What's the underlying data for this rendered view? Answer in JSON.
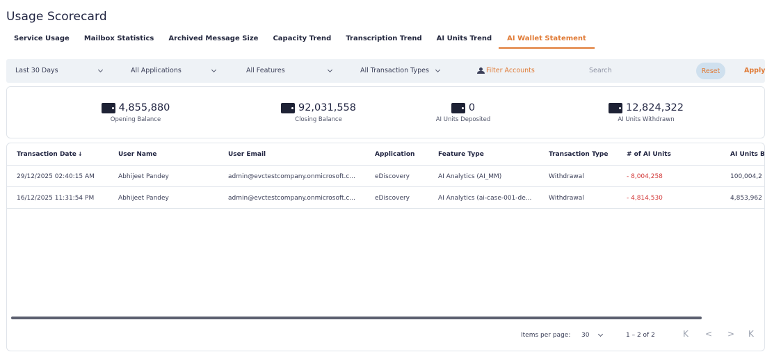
{
  "page": {
    "title": "Usage Scorecard"
  },
  "tabs": [
    {
      "label": "Service Usage",
      "active": false
    },
    {
      "label": "Mailbox Statistics",
      "active": false
    },
    {
      "label": "Archived Message Size",
      "active": false
    },
    {
      "label": "Capacity Trend",
      "active": false
    },
    {
      "label": "Transcription Trend",
      "active": false
    },
    {
      "label": "AI Units Trend",
      "active": false
    },
    {
      "label": "AI Wallet Statement",
      "active": true
    }
  ],
  "filters": {
    "date_range": "Last 30 Days",
    "applications": "All Applications",
    "features": "All Features",
    "transaction_types": "All Transaction Types",
    "filter_accounts": "Filter Accounts",
    "search_placeholder": "Search",
    "reset_label": "Reset",
    "apply_label": "Apply"
  },
  "summary": [
    {
      "value": "4,855,880",
      "label": "Opening Balance",
      "icon": "wallet-icon"
    },
    {
      "value": "92,031,558",
      "label": "Closing Balance",
      "icon": "wallet-icon"
    },
    {
      "value": "0",
      "label": "AI Units Deposited",
      "icon": "wallet-icon"
    },
    {
      "value": "12,824,322",
      "label": "AI Units Withdrawn",
      "icon": "wallet-icon"
    }
  ],
  "table": {
    "columns": [
      "Transaction Date",
      "User Name",
      "User Email",
      "Application",
      "Feature Type",
      "Transaction Type",
      "# of AI Units",
      "AI Units B"
    ],
    "sort_indicator": "↓",
    "rows": [
      {
        "date": "29/12/2025 02:40:15 AM",
        "user_name": "Abhijeet Pandey",
        "email": "admin@evctestcompany.onmicrosoft.c...",
        "application": "eDiscovery",
        "feature": "AI Analytics (AI_MM)",
        "transaction_type": "Withdrawal",
        "units": "- 8,004,258",
        "balance": "100,004,2"
      },
      {
        "date": "16/12/2025 11:31:54 PM",
        "user_name": "Abhijeet Pandey",
        "email": "admin@evctestcompany.onmicrosoft.c...",
        "application": "eDiscovery",
        "feature": "AI Analytics (ai-case-001-de...",
        "transaction_type": "Withdrawal",
        "units": "- 4,814,530",
        "balance": "4,853,962"
      }
    ]
  },
  "pagination": {
    "items_per_page_label": "Items per page:",
    "items_per_page": "30",
    "range": "1 – 2 of 2",
    "first": "K",
    "prev": "<",
    "next": ">",
    "last": "K"
  },
  "colors": {
    "accent": "#e07a35",
    "negative": "#d33a3a",
    "filter_bg": "#eef2f6"
  }
}
